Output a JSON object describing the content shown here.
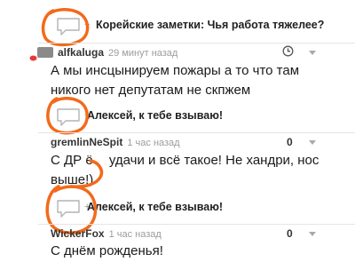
{
  "threads": [
    {
      "title": "Корейские заметки: Чья работа тяжелее?",
      "author": "alfkaluga",
      "time": "29 минут назад",
      "score": "",
      "comment": "А мы инсцынируем пожары а то что там никого нет депутатам не скпжем"
    },
    {
      "title": "Алексей, к тебе взываю!",
      "author": "gremlinNeSpit",
      "time": "1 час назад",
      "score": "0",
      "comment_start": "С ДР ё",
      "comment_mid": "удачи и всё такое! Не хандри, нос",
      "comment_end": "выше!)"
    },
    {
      "title": "Алексей, к тебе взываю!",
      "author": "WickerFox",
      "time": "1 час назад",
      "score": "0",
      "comment": "С днём рожденья!"
    }
  ],
  "icons": {
    "comment": "speech-bubble-icon",
    "clock": "clock-icon",
    "vote_down": "triangle-down-icon",
    "avatar": "avatar-bird-icon"
  },
  "plus_sign": "+",
  "colors": {
    "annotation": "#f26a1b",
    "bubble_stroke": "#b4b4b4",
    "separator": "#e5e5e5",
    "muted_text": "#9c9c9c"
  }
}
